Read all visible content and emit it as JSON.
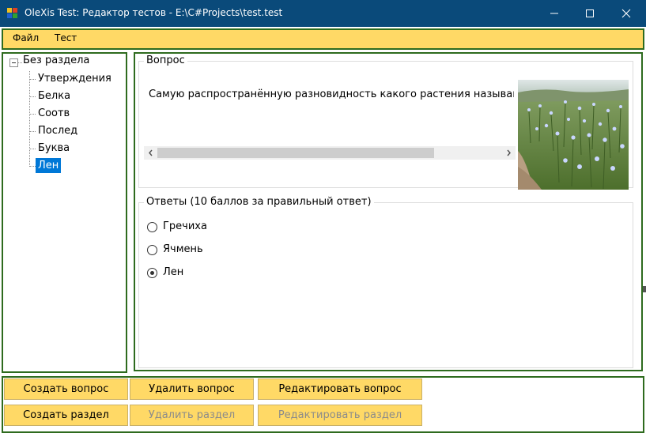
{
  "window": {
    "title": "OleXis Test: Редактор тестов - E:\\C#Projects\\test.test",
    "colors": {
      "titlebar": "#0a4a7a",
      "accent_yellow": "#ffd966",
      "border_green": "#2e6b1e",
      "selection": "#0078d7"
    },
    "controls": {
      "minimize": "minimize-icon",
      "maximize": "maximize-icon",
      "close": "close-icon"
    }
  },
  "menu": {
    "items": [
      {
        "label": "Файл"
      },
      {
        "label": "Тест"
      }
    ]
  },
  "tree": {
    "root": "Без раздела",
    "items": [
      {
        "label": "Утверждения"
      },
      {
        "label": "Белка"
      },
      {
        "label": "Соотв"
      },
      {
        "label": "Послед"
      },
      {
        "label": "Буква"
      },
      {
        "label": "Лен",
        "selected": true
      }
    ]
  },
  "question": {
    "group_title": "Вопрос",
    "text": "Самую распространённую разновидность какого растения называют",
    "image": "flax-field-photo"
  },
  "answers": {
    "group_title": "Ответы (10 баллов за правильный ответ)",
    "options": [
      {
        "label": "Гречиха",
        "checked": false
      },
      {
        "label": "Ячмень",
        "checked": false
      },
      {
        "label": "Лен",
        "checked": true
      }
    ]
  },
  "buttons": {
    "create_question": "Создать вопрос",
    "delete_question": "Удалить вопрос",
    "edit_question": "Редактировать вопрос",
    "create_section": "Создать раздел",
    "delete_section": "Удалить раздел",
    "edit_section": "Редактировать раздел",
    "delete_section_enabled": false,
    "edit_section_enabled": false
  }
}
